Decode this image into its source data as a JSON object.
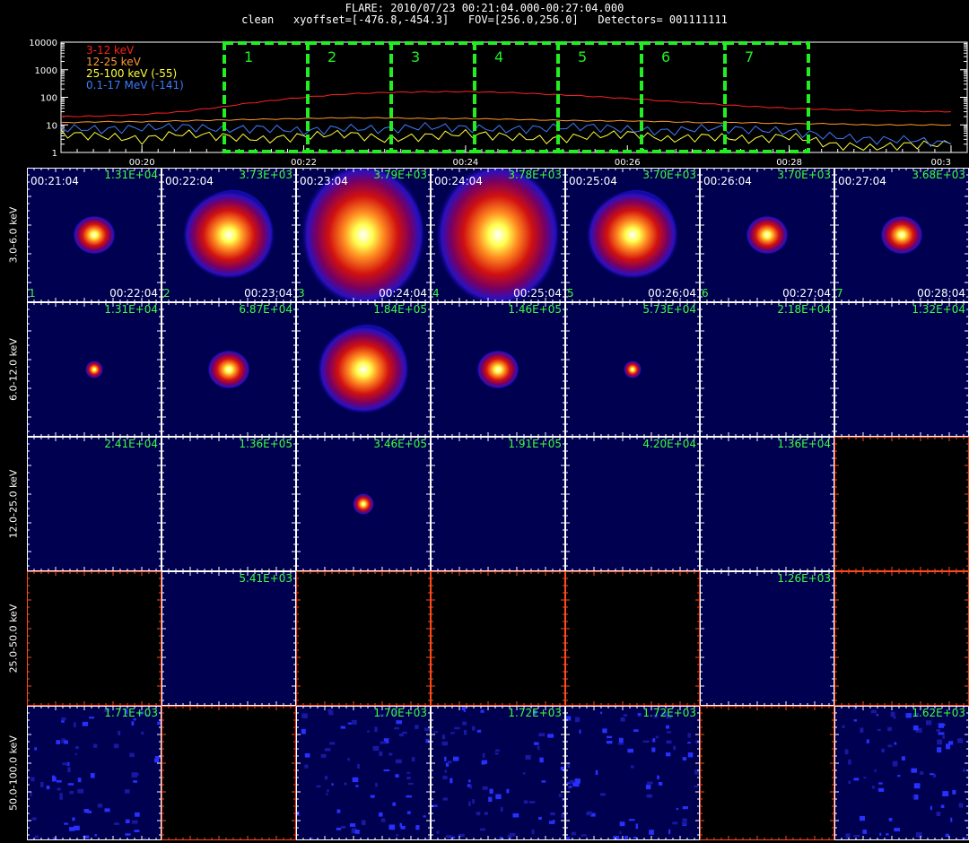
{
  "header": {
    "line1": "FLARE: 2010/07/23 00:21:04.000-00:27:04.000",
    "line2": "clean   xyoffset=[-476.8,-454.3]   FOV=[256.0,256.0]   Detectors= 001111111"
  },
  "chart_data": [
    {
      "type": "line",
      "title": "",
      "xlabel": "",
      "ylabel": "",
      "log_y": true,
      "ylim": [
        1,
        10000
      ],
      "ytick_labels": [
        "1",
        "10",
        "100",
        "1000",
        "10000"
      ],
      "xtick_labels": [
        "00:20",
        "00:22",
        "00:24",
        "00:26",
        "00:28",
        "00:3"
      ],
      "x_minutes": [
        19.0,
        19.5,
        20.0,
        20.5,
        21.0,
        21.5,
        22.0,
        22.5,
        23.0,
        23.5,
        24.0,
        24.5,
        25.0,
        25.5,
        26.0,
        26.5,
        27.0,
        27.5,
        28.0,
        28.5,
        29.0,
        29.5,
        30.0
      ],
      "series": [
        {
          "name": "3-12 keV",
          "color": "#ff2020",
          "values": [
            20,
            21,
            24,
            30,
            45,
            70,
            100,
            130,
            150,
            158,
            160,
            150,
            130,
            110,
            90,
            72,
            58,
            47,
            40,
            36,
            33,
            31,
            30
          ]
        },
        {
          "name": "12-25 keV",
          "color": "#ff9a2e",
          "values": [
            12,
            13,
            13,
            14,
            15,
            16,
            17,
            18,
            18,
            17,
            17,
            16,
            15,
            14,
            14,
            13,
            12,
            12,
            11,
            11,
            10,
            10,
            10
          ]
        },
        {
          "name": "25-100 keV (-55)",
          "color": "#ffff40",
          "values": [
            5,
            4,
            3,
            5,
            4,
            3,
            4,
            5,
            3,
            4,
            5,
            4,
            3,
            4,
            5,
            3,
            4,
            3,
            4,
            2,
            1.5,
            2,
            2
          ]
        },
        {
          "name": "0.1-17 MeV (-141)",
          "color": "#3c7cff",
          "values": [
            8,
            7,
            8,
            9,
            7,
            8,
            6,
            8,
            7,
            9,
            8,
            7,
            8,
            9,
            7,
            6,
            8,
            7,
            6,
            4,
            3,
            3,
            2
          ]
        }
      ],
      "intervals": [
        "1",
        "2",
        "3",
        "4",
        "5",
        "6",
        "7"
      ],
      "interval_color": "#22ee22"
    },
    {
      "type": "heatmap",
      "energy_bands": [
        "3.0-6.0 keV",
        "6.0-12.0 keV",
        "12.0-25.0 keV",
        "25.0-50.0 keV",
        "50.0-100.0 keV"
      ],
      "time_start": [
        "00:21:04",
        "00:22:04",
        "00:23:04",
        "00:24:04",
        "00:25:04",
        "00:26:04",
        "00:27:04"
      ],
      "time_end": [
        "00:22:04",
        "00:23:04",
        "00:24:04",
        "00:25:04",
        "00:26:04",
        "00:27:04",
        "00:28:04"
      ],
      "interval_index": [
        "1",
        "2",
        "3",
        "4",
        "5",
        "6",
        "7"
      ],
      "peak_values": [
        [
          "1.31E+04",
          "3.73E+03",
          "3.79E+03",
          "3.78E+03",
          "3.70E+03",
          "3.70E+03",
          "3.68E+03"
        ],
        [
          "1.31E+04",
          "6.87E+04",
          "1.84E+05",
          "1.46E+05",
          "5.73E+04",
          "2.18E+04",
          "1.32E+04"
        ],
        [
          "2.41E+04",
          "1.36E+05",
          "3.46E+05",
          "1.91E+05",
          "4.20E+04",
          "1.36E+04",
          ""
        ],
        [
          "",
          "5.41E+03",
          "",
          "",
          "",
          "1.26E+03",
          ""
        ],
        [
          "1.71E+03",
          "",
          "1.70E+03",
          "1.72E+03",
          "1.72E+03",
          "",
          "1.62E+03"
        ]
      ],
      "image_style": [
        [
          "small",
          "medium",
          "large",
          "large",
          "medium",
          "small",
          "small"
        ],
        [
          "dot",
          "small",
          "medium",
          "small",
          "dot",
          "none",
          "none"
        ],
        [
          "none",
          "none",
          "tiny",
          "none",
          "none",
          "none",
          "empty"
        ],
        [
          "empty",
          "none",
          "empty",
          "empty",
          "empty",
          "none",
          "empty"
        ],
        [
          "noise",
          "empty",
          "noise",
          "noise",
          "noise",
          "empty",
          "noise"
        ]
      ]
    }
  ]
}
